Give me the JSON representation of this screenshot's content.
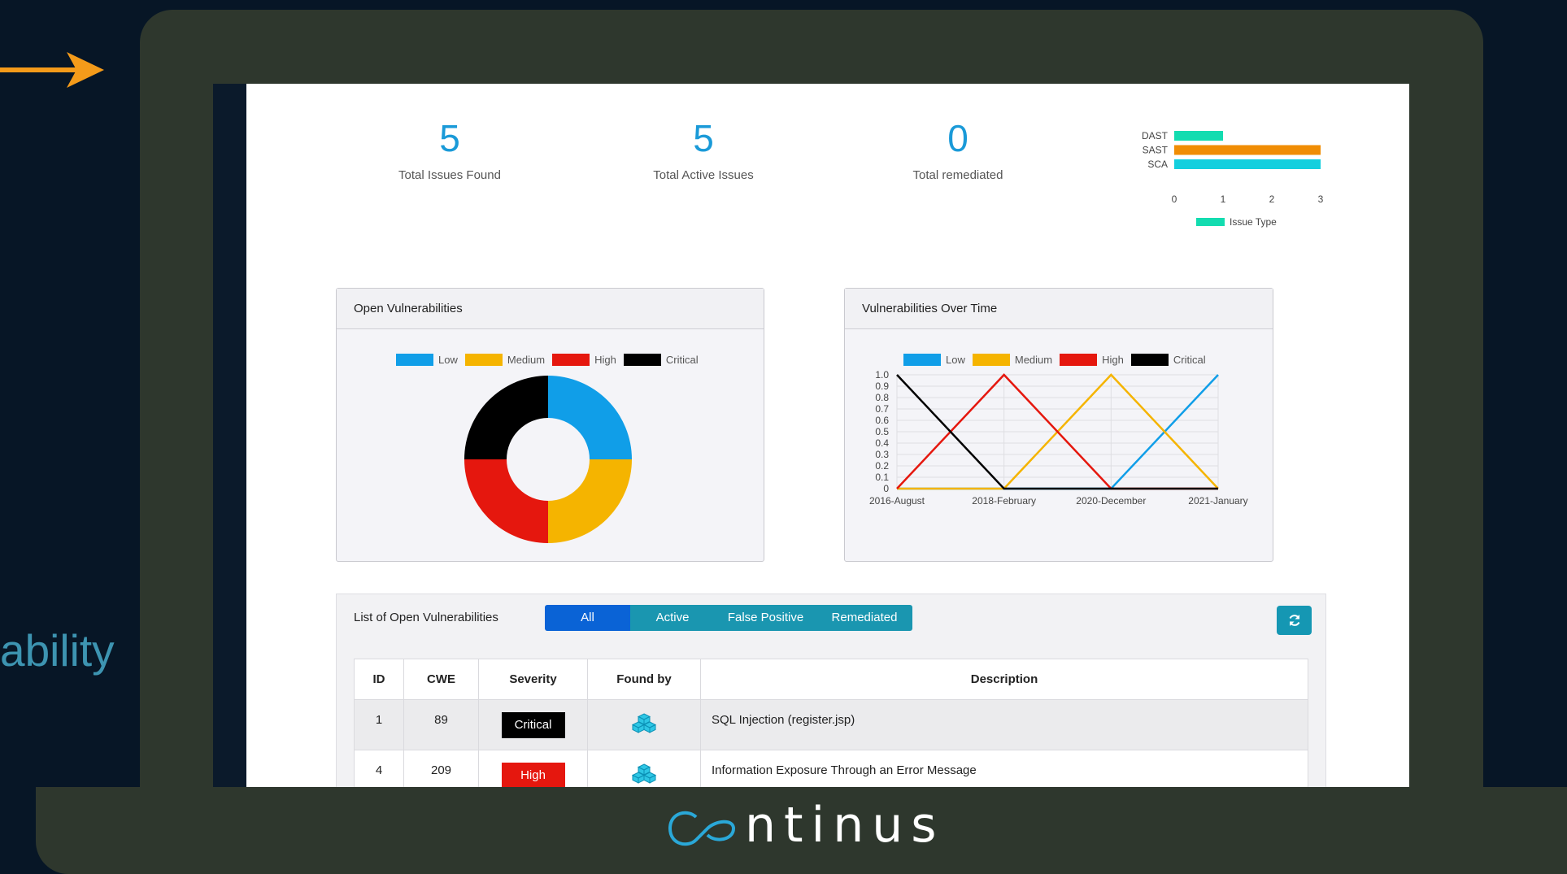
{
  "side_text": "ability",
  "brand": {
    "logo_text": "continus"
  },
  "stats": [
    {
      "value": "5",
      "label": "Total Issues Found"
    },
    {
      "value": "5",
      "label": "Total Active Issues"
    },
    {
      "value": "0",
      "label": "Total remediated"
    }
  ],
  "issue_type_chart": {
    "categories": [
      "DAST",
      "SAST",
      "SCA"
    ],
    "ticks": [
      "0",
      "1",
      "2",
      "3"
    ],
    "legend_label": "Issue Type"
  },
  "open_vulns": {
    "title": "Open Vulnerabilities",
    "legend": [
      "Low",
      "Medium",
      "High",
      "Critical"
    ]
  },
  "over_time": {
    "title": "Vulnerabilities Over Time",
    "legend": [
      "Low",
      "Medium",
      "High",
      "Critical"
    ]
  },
  "colors": {
    "low": "#109ee8",
    "medium": "#f5b400",
    "high": "#e5170e",
    "critical": "#000000",
    "dast": "#13dcb0",
    "sast": "#f08d05",
    "sca": "#14cfde"
  },
  "chart_data": [
    {
      "type": "bar",
      "orientation": "horizontal",
      "categories": [
        "DAST",
        "SAST",
        "SCA"
      ],
      "values": [
        1,
        3,
        3
      ],
      "xlim": [
        0,
        3
      ],
      "legend": "bottom"
    },
    {
      "type": "pie",
      "donut": true,
      "labels": [
        "Low",
        "Medium",
        "High",
        "Critical"
      ],
      "values": [
        1,
        1,
        1,
        1
      ],
      "legend": "top"
    },
    {
      "type": "line",
      "x": [
        "2016-August",
        "2018-February",
        "2020-December",
        "2021-January"
      ],
      "series": [
        {
          "name": "Low",
          "values": [
            0,
            0,
            0,
            1
          ]
        },
        {
          "name": "Medium",
          "values": [
            0,
            0,
            1,
            0
          ]
        },
        {
          "name": "High",
          "values": [
            0,
            1,
            0,
            0
          ]
        },
        {
          "name": "Critical",
          "values": [
            1,
            0,
            0,
            0
          ]
        }
      ],
      "ylim": [
        0,
        1
      ],
      "yticks": [
        "0",
        "0.1",
        "0.2",
        "0.3",
        "0.4",
        "0.5",
        "0.6",
        "0.7",
        "0.8",
        "0.9",
        "1.0"
      ],
      "grid": true,
      "legend": "top"
    }
  ],
  "list": {
    "title": "List of Open Vulnerabilities",
    "tabs": [
      "All",
      "Active",
      "False Positive",
      "Remediated"
    ],
    "active_tab": "All",
    "columns": [
      "ID",
      "CWE",
      "Severity",
      "Found by",
      "Description"
    ],
    "rows": [
      {
        "id": "1",
        "cwe": "89",
        "severity": "Critical",
        "found_by_icon": "cubes-icon",
        "description": "SQL Injection (register.jsp)"
      },
      {
        "id": "4",
        "cwe": "209",
        "severity": "High",
        "found_by_icon": "cubes-icon",
        "description": "Information Exposure Through an Error Message"
      }
    ]
  }
}
